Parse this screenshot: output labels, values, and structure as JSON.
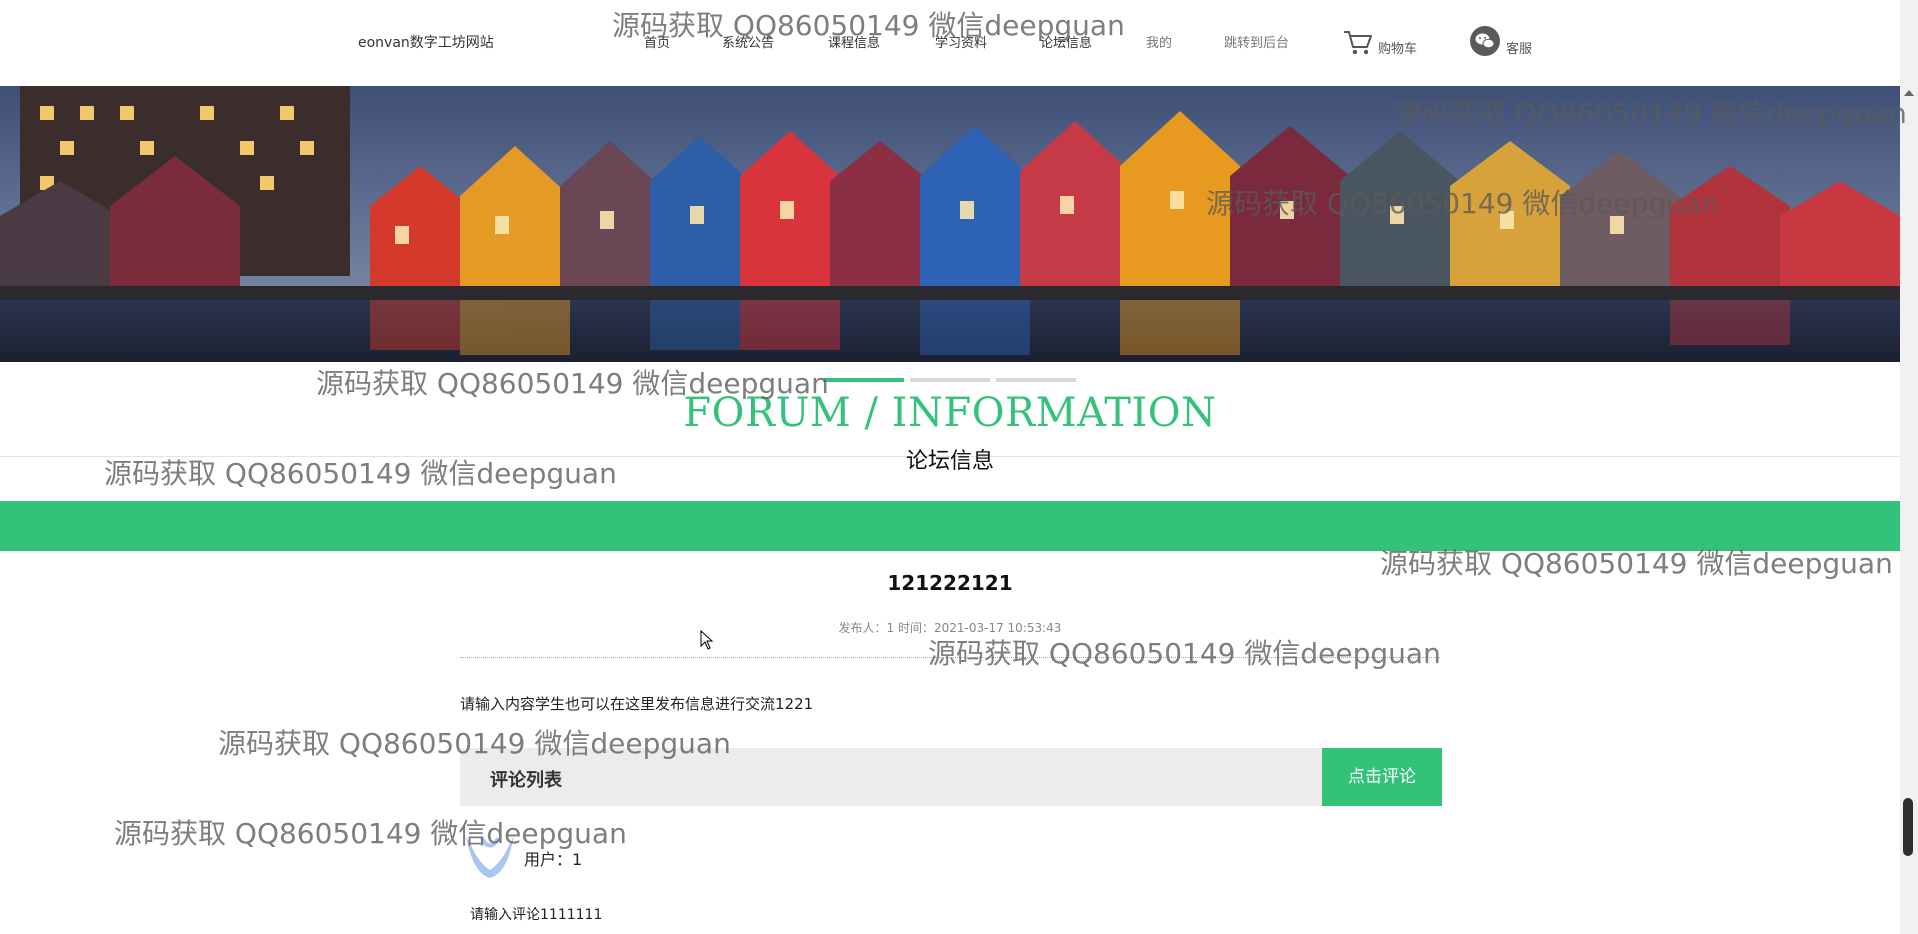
{
  "header": {
    "site_name": "eonvan数字工坊网站",
    "nav": [
      {
        "label": "首页"
      },
      {
        "label": "系统公告"
      },
      {
        "label": "课程信息"
      },
      {
        "label": "学习资料"
      },
      {
        "label": "论坛信息"
      },
      {
        "label": "我的"
      },
      {
        "label": "跳转到后台"
      }
    ],
    "cart_label": "购物车",
    "service_label": "客服"
  },
  "banner": {
    "slide_count": 3,
    "active_slide": 1
  },
  "section": {
    "title_en": "FORUM / INFORMATION",
    "title_cn": "论坛信息"
  },
  "post": {
    "title": "121222121",
    "meta": "发布人：1 时间：2021-03-17 10:53:43",
    "content": "请输入内容学生也可以在这里发布信息进行交流1221"
  },
  "comments": {
    "header_label": "评论列表",
    "button_label": "点击评论",
    "items": [
      {
        "user": "用户：1",
        "text": "请输入评论1111111"
      }
    ]
  },
  "watermark": "源码获取 QQ86050149 微信deepguan",
  "colors": {
    "accent": "#34c17a",
    "comment_header_bg": "#ececec"
  },
  "icons": [
    "cart-icon",
    "wechat-icon",
    "avatar-icon"
  ]
}
